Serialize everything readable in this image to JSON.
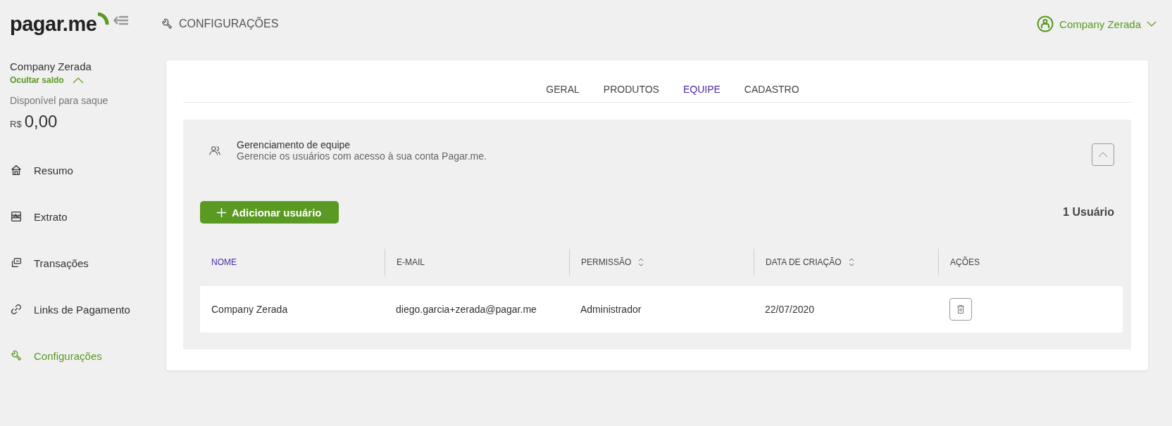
{
  "header": {
    "logo": "pagar.me",
    "page_title": "CONFIGURAÇÕES",
    "account": "Company Zerada"
  },
  "sidebar": {
    "company": "Company Zerada",
    "toggle_balance": "Ocultar saldo",
    "balance_label": "Disponível para saque",
    "currency": "R$",
    "balance": "0,00",
    "items": [
      {
        "label": "Resumo",
        "selected": false
      },
      {
        "label": "Extrato",
        "selected": false
      },
      {
        "label": "Transações",
        "selected": false
      },
      {
        "label": "Links de Pagamento",
        "selected": false
      },
      {
        "label": "Configurações",
        "selected": true
      }
    ]
  },
  "tabs": [
    {
      "label": "GERAL",
      "selected": false
    },
    {
      "label": "PRODUTOS",
      "selected": false
    },
    {
      "label": "EQUIPE",
      "selected": true
    },
    {
      "label": "CADASTRO",
      "selected": false
    }
  ],
  "section": {
    "title": "Gerenciamento de equipe",
    "subtitle": "Gerencie os usuários com acesso à sua conta Pagar.me.",
    "expanded": true
  },
  "add_button": "Adicionar usuário",
  "user_count": "1 Usuário",
  "table": {
    "columns": [
      {
        "label": "NOME",
        "sortable": false,
        "selected": true
      },
      {
        "label": "E-MAIL",
        "sortable": false,
        "selected": false
      },
      {
        "label": "PERMISSÃO",
        "sortable": true,
        "selected": false
      },
      {
        "label": "DATA DE CRIAÇÃO",
        "sortable": true,
        "selected": false
      },
      {
        "label": "AÇÕES",
        "sortable": false,
        "selected": false
      }
    ],
    "rows": [
      {
        "cells": [
          "Company Zerada",
          "diego.garcia+zerada@pagar.me",
          "Administrador",
          "22/07/2020"
        ]
      }
    ]
  }
}
